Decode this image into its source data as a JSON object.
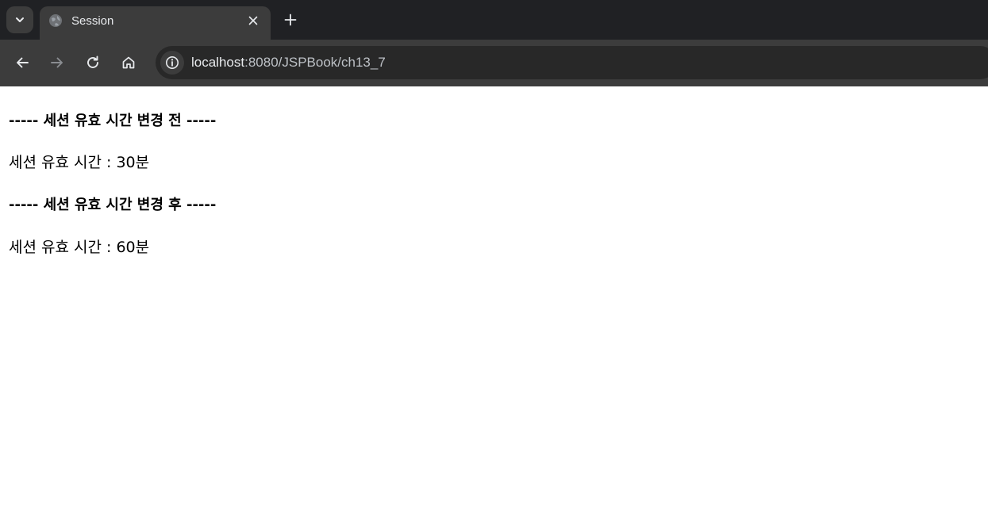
{
  "browser": {
    "tab": {
      "title": "Session"
    },
    "address_bar": {
      "host": "localhost",
      "rest": ":8080/JSPBook/ch13_7"
    },
    "icons": {
      "tab_search": "chevron-down-icon",
      "favicon": "globe-icon",
      "close": "close-icon",
      "new_tab": "plus-icon",
      "back": "arrow-left-icon",
      "forward": "arrow-right-icon",
      "reload": "reload-icon",
      "home": "home-icon",
      "site_info": "info-icon"
    }
  },
  "page": {
    "before_heading": "----- 세션 유효 시간 변경 전 -----",
    "before_value": "세션 유효 시간 : 30분",
    "after_heading": "----- 세션 유효 시간 변경 후 -----",
    "after_value": "세션 유효 시간 : 60분"
  }
}
